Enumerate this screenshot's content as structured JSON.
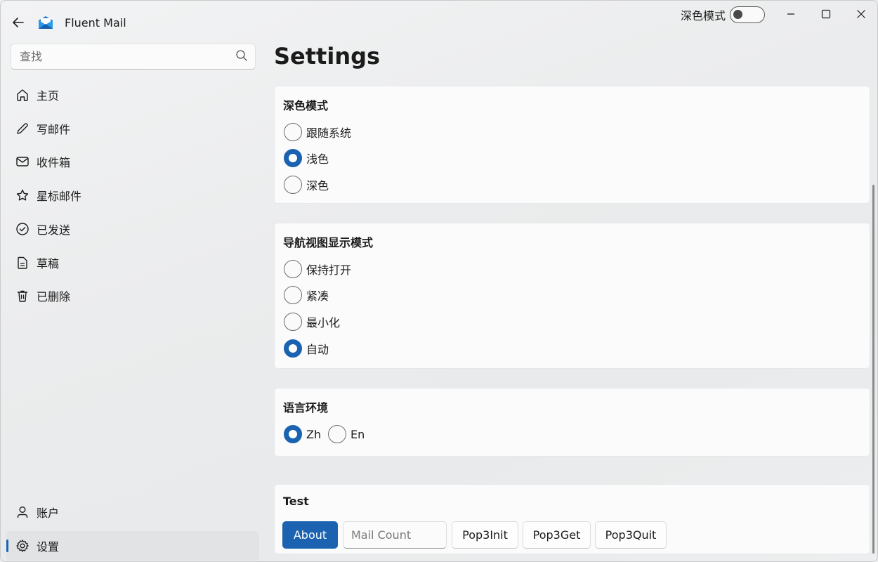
{
  "app": {
    "title": "Fluent Mail"
  },
  "titlebar": {
    "theme_toggle_label": "深色模式"
  },
  "search": {
    "placeholder": "查找"
  },
  "sidebar": {
    "items": [
      {
        "label": "主页",
        "icon": "home-icon"
      },
      {
        "label": "写邮件",
        "icon": "pencil-icon"
      },
      {
        "label": "收件箱",
        "icon": "mail-icon"
      },
      {
        "label": "星标邮件",
        "icon": "star-icon"
      },
      {
        "label": "已发送",
        "icon": "check-circle-icon"
      },
      {
        "label": "草稿",
        "icon": "document-icon"
      },
      {
        "label": "已删除",
        "icon": "trash-icon"
      }
    ],
    "footer": [
      {
        "label": "账户",
        "icon": "person-icon"
      },
      {
        "label": "设置",
        "icon": "gear-icon",
        "active": true
      }
    ]
  },
  "main": {
    "title": "Settings",
    "theme_card": {
      "title": "深色模式",
      "options": [
        "跟随系统",
        "浅色",
        "深色"
      ],
      "selected": "浅色"
    },
    "nav_card": {
      "title": "导航视图显示模式",
      "options": [
        "保持打开",
        "紧凑",
        "最小化",
        "自动"
      ],
      "selected": "自动"
    },
    "lang_card": {
      "title": "语言环境",
      "options": [
        "Zh",
        "En"
      ],
      "selected": "Zh"
    },
    "test_card": {
      "title": "Test",
      "about_label": "About",
      "mail_count_placeholder": "Mail Count",
      "pop3init_label": "Pop3Init",
      "pop3get_label": "Pop3Get",
      "pop3quit_label": "Pop3Quit"
    }
  },
  "colors": {
    "accent": "#1b63b0"
  }
}
